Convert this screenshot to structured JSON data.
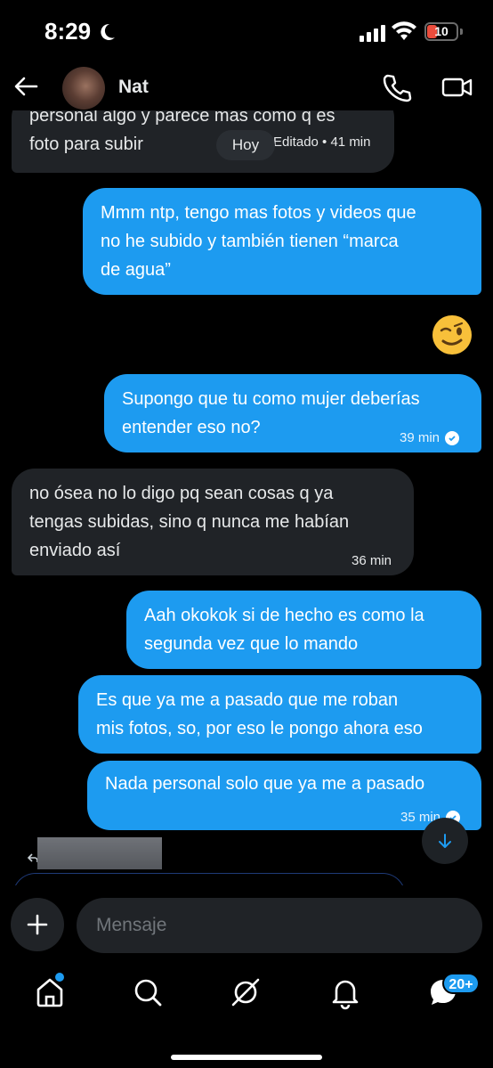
{
  "status_bar": {
    "time": "8:29",
    "battery": "10"
  },
  "header": {
    "contact_name": "Nat"
  },
  "chat": {
    "date_pill": "Hoy",
    "messages": [
      {
        "direction": "in",
        "text": "personal algo y parece mas como q es\nfoto para subir",
        "meta": "Editado • 41 min"
      },
      {
        "direction": "out",
        "text": "Mmm ntp, tengo mas fotos y videos que\nno he subido y también tienen “marca\nde agua”",
        "meta": ""
      },
      {
        "direction": "out",
        "text": "Supongo que tu como mujer deberías\nentender eso no?",
        "meta": "39 min"
      },
      {
        "direction": "in",
        "text": "no ósea no lo digo pq sean cosas q ya\ntengas subidas, sino q nunca me habían\nenviado así",
        "meta": "36 min"
      },
      {
        "direction": "out",
        "text": "Aah okokok si de hecho es como la\nsegunda vez que lo mando",
        "meta": ""
      },
      {
        "direction": "out",
        "text": "Es que ya me a pasado que me roban\nmis fotos, so, por eso le pongo ahora eso",
        "meta": ""
      },
      {
        "direction": "out",
        "text": "Nada personal solo que ya me a pasado",
        "meta": "35 min"
      }
    ],
    "emoji_reaction": "winking-face"
  },
  "composer": {
    "placeholder": "Mensaje"
  },
  "tabbar": {
    "messages_badge": "20+"
  },
  "colors": {
    "accent": "#1d9bf0",
    "incoming_bubble": "#202327",
    "background": "#000000"
  }
}
